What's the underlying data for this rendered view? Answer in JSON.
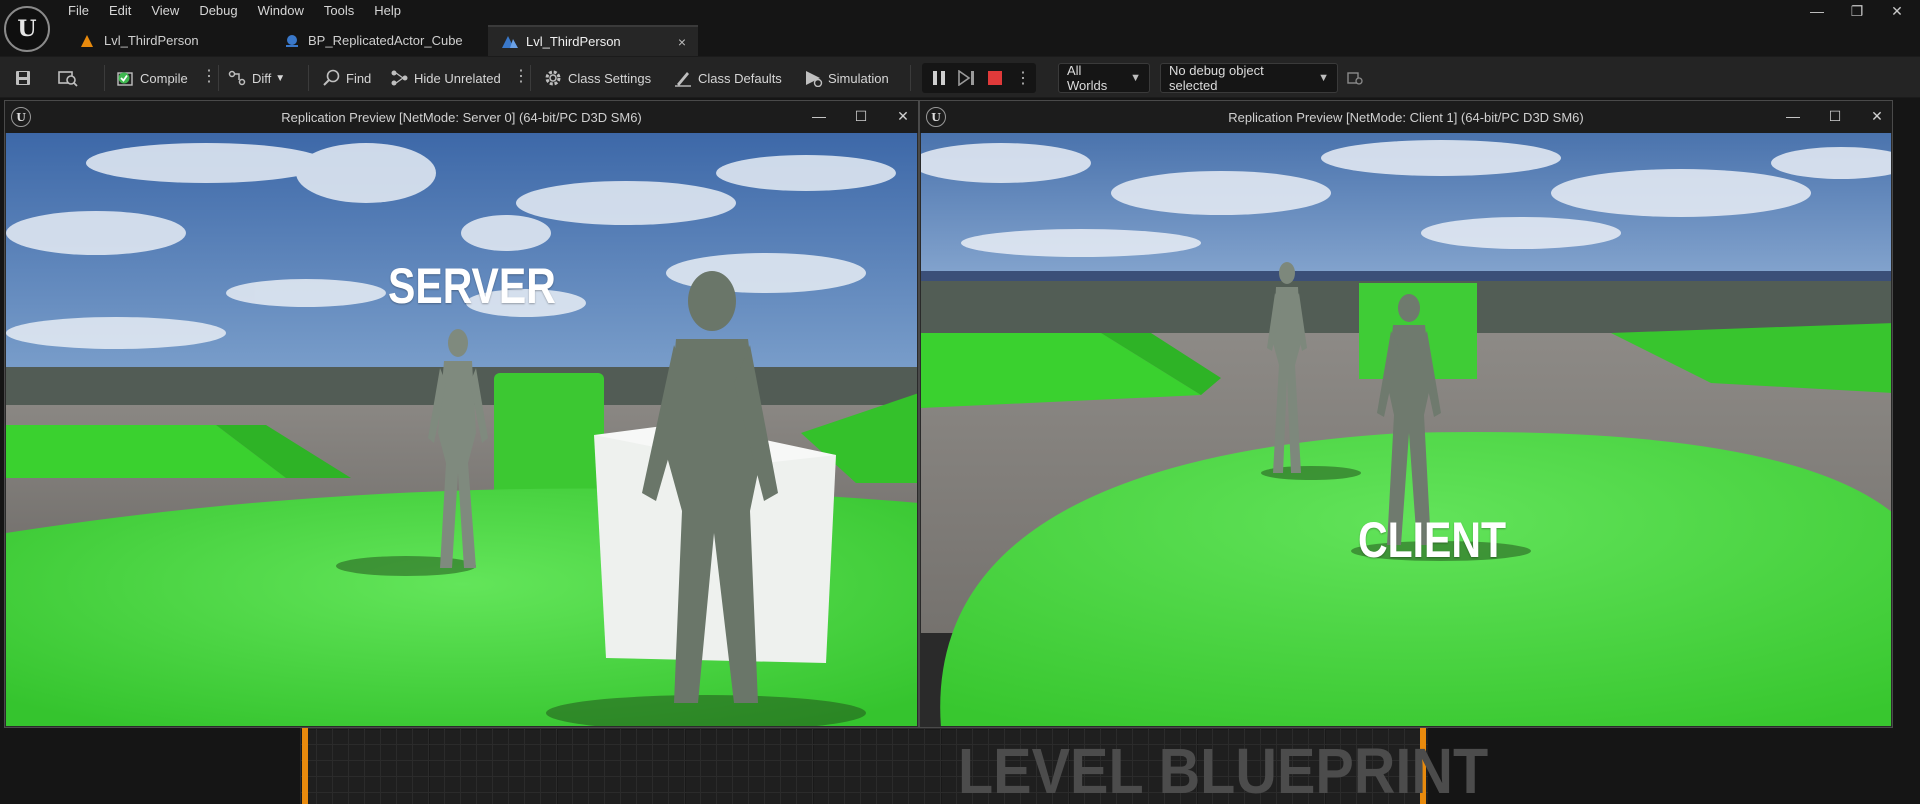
{
  "app": {
    "logo_letter": "U",
    "logo_icon": "unreal-logo-icon"
  },
  "menu": {
    "items": [
      "File",
      "Edit",
      "View",
      "Debug",
      "Window",
      "Tools",
      "Help"
    ]
  },
  "window_controls": {
    "minimize": "—",
    "maximize": "❐",
    "close": "✕"
  },
  "tabs": [
    {
      "label": "Lvl_ThirdPerson",
      "icon": "level-icon",
      "active": false
    },
    {
      "label": "BP_ReplicatedActor_Cube",
      "icon": "blueprint-icon",
      "active": false
    },
    {
      "label": "Lvl_ThirdPerson",
      "icon": "level-blueprint-icon",
      "active": true,
      "close": "×"
    }
  ],
  "toolbar": {
    "compile": "Compile",
    "diff": "Diff",
    "find": "Find",
    "hide_unrelated": "Hide Unrelated",
    "class_settings": "Class Settings",
    "class_defaults": "Class Defaults",
    "simulation": "Simulation",
    "worlds": "All Worlds",
    "debug_object": "No debug object selected"
  },
  "colors": {
    "accent_orange": "#e88a0d",
    "stop_red": "#e03a3a",
    "compile_ok_green": "#3fb950",
    "floor_green": "#3fd83a"
  },
  "server_window": {
    "title": "Replication Preview [NetMode: Server 0]  (64-bit/PC D3D SM6)",
    "overlay": "SERVER"
  },
  "client_window": {
    "title": "Replication Preview [NetMode: Client 1]  (64-bit/PC D3D SM6)",
    "overlay": "CLIENT"
  },
  "graph": {
    "watermark": "LEVEL BLUEPRINT"
  }
}
